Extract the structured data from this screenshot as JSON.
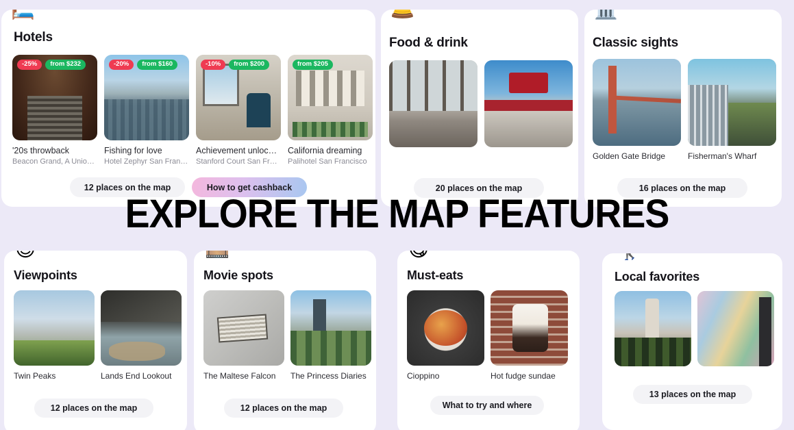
{
  "headline": "EXPLORE THE MAP FEATURES",
  "theme": {
    "page_background": "#ece9f7",
    "card_background": "#ffffff",
    "badge_discount_color": "#ef3b52",
    "badge_price_color": "#1bb760",
    "pill_background": "#f3f3f6",
    "cashback_gradient_from": "#f4b7dd",
    "cashback_gradient_to": "#a8c7f0"
  },
  "cards": [
    {
      "id": "hotels",
      "emoji": "🛏️",
      "emoji_name": "bed-emoji",
      "title": "Hotels",
      "items": [
        {
          "discount": "-25%",
          "price": "from $232",
          "caption": "'20s throwback",
          "subcaption": "Beacon Grand, A Union S...",
          "art": "ph-stairs"
        },
        {
          "discount": "-20%",
          "price": "from $160",
          "caption": "Fishing for love",
          "subcaption": "Hotel Zephyr San Francisco",
          "art": "ph-wharf"
        },
        {
          "discount": "-10%",
          "price": "from $200",
          "caption": "Achievement unlocked!",
          "subcaption": "Stanford Court San Franci...",
          "art": "ph-room"
        },
        {
          "discount": "",
          "price": "from $205",
          "caption": "California dreaming",
          "subcaption": "Palihotel San Francisco",
          "art": "ph-facade"
        }
      ],
      "pills": [
        {
          "label": "12 places on the map",
          "style": "plain"
        },
        {
          "label": "How to get cashback",
          "style": "gradient"
        }
      ]
    },
    {
      "id": "food-drink",
      "emoji": "🛎️",
      "emoji_name": "bellhop-bell-emoji",
      "title": "Food & drink",
      "items": [
        {
          "discount": "",
          "price": "",
          "caption": "",
          "subcaption": "",
          "art": "ph-patio"
        },
        {
          "discount": "",
          "price": "",
          "caption": "",
          "subcaption": "",
          "art": "ph-gotts"
        }
      ],
      "pills": [
        {
          "label": "20 places on the map",
          "style": "plain"
        }
      ]
    },
    {
      "id": "classic-sights",
      "emoji": "🏛️",
      "emoji_name": "classical-building-emoji",
      "title": "Classic sights",
      "items": [
        {
          "discount": "",
          "price": "",
          "caption": "Golden Gate Bridge",
          "subcaption": "",
          "art": "ph-ggb"
        },
        {
          "discount": "",
          "price": "",
          "caption": "Fisherman's Wharf",
          "subcaption": "",
          "art": "ph-fw"
        }
      ],
      "pills": [
        {
          "label": "16 places on the map",
          "style": "plain"
        }
      ]
    },
    {
      "id": "viewpoints",
      "emoji": "😎",
      "emoji_name": "sunglasses-face-emoji",
      "title": "Viewpoints",
      "items": [
        {
          "discount": "",
          "price": "",
          "caption": "Twin Peaks",
          "subcaption": "",
          "art": "ph-twin"
        },
        {
          "discount": "",
          "price": "",
          "caption": "Lands End Lookout",
          "subcaption": "",
          "art": "ph-lands"
        }
      ],
      "pills": [
        {
          "label": "12 places on the map",
          "style": "plain"
        }
      ]
    },
    {
      "id": "movie-spots",
      "emoji": "🎞️",
      "emoji_name": "film-frames-emoji",
      "title": "Movie spots",
      "items": [
        {
          "discount": "",
          "price": "",
          "caption": "The Maltese Falcon",
          "subcaption": "",
          "art": "ph-plaque"
        },
        {
          "discount": "",
          "price": "",
          "caption": "The Princess Diaries",
          "subcaption": "",
          "art": "ph-street"
        }
      ],
      "pills": [
        {
          "label": "12 places on the map",
          "style": "plain"
        }
      ]
    },
    {
      "id": "must-eats",
      "emoji": "😋",
      "emoji_name": "face-savoring-food-emoji",
      "title": "Must-eats",
      "items": [
        {
          "discount": "",
          "price": "",
          "caption": "Cioppino",
          "subcaption": "",
          "art": "ph-cioppino"
        },
        {
          "discount": "",
          "price": "",
          "caption": "Hot fudge sundae",
          "subcaption": "",
          "art": "ph-sundae"
        }
      ],
      "pills": [
        {
          "label": "What to try and where",
          "style": "plain"
        }
      ]
    },
    {
      "id": "local-favorites",
      "emoji": "🚶‍♀️",
      "emoji_name": "woman-walking-emoji",
      "title": "Local favorites",
      "items": [
        {
          "discount": "",
          "price": "",
          "caption": "",
          "subcaption": "",
          "art": "ph-ferry"
        },
        {
          "discount": "",
          "price": "",
          "caption": "",
          "subcaption": "",
          "art": "ph-mural"
        }
      ],
      "pills": [
        {
          "label": "13 places on the map",
          "style": "plain"
        }
      ]
    }
  ]
}
